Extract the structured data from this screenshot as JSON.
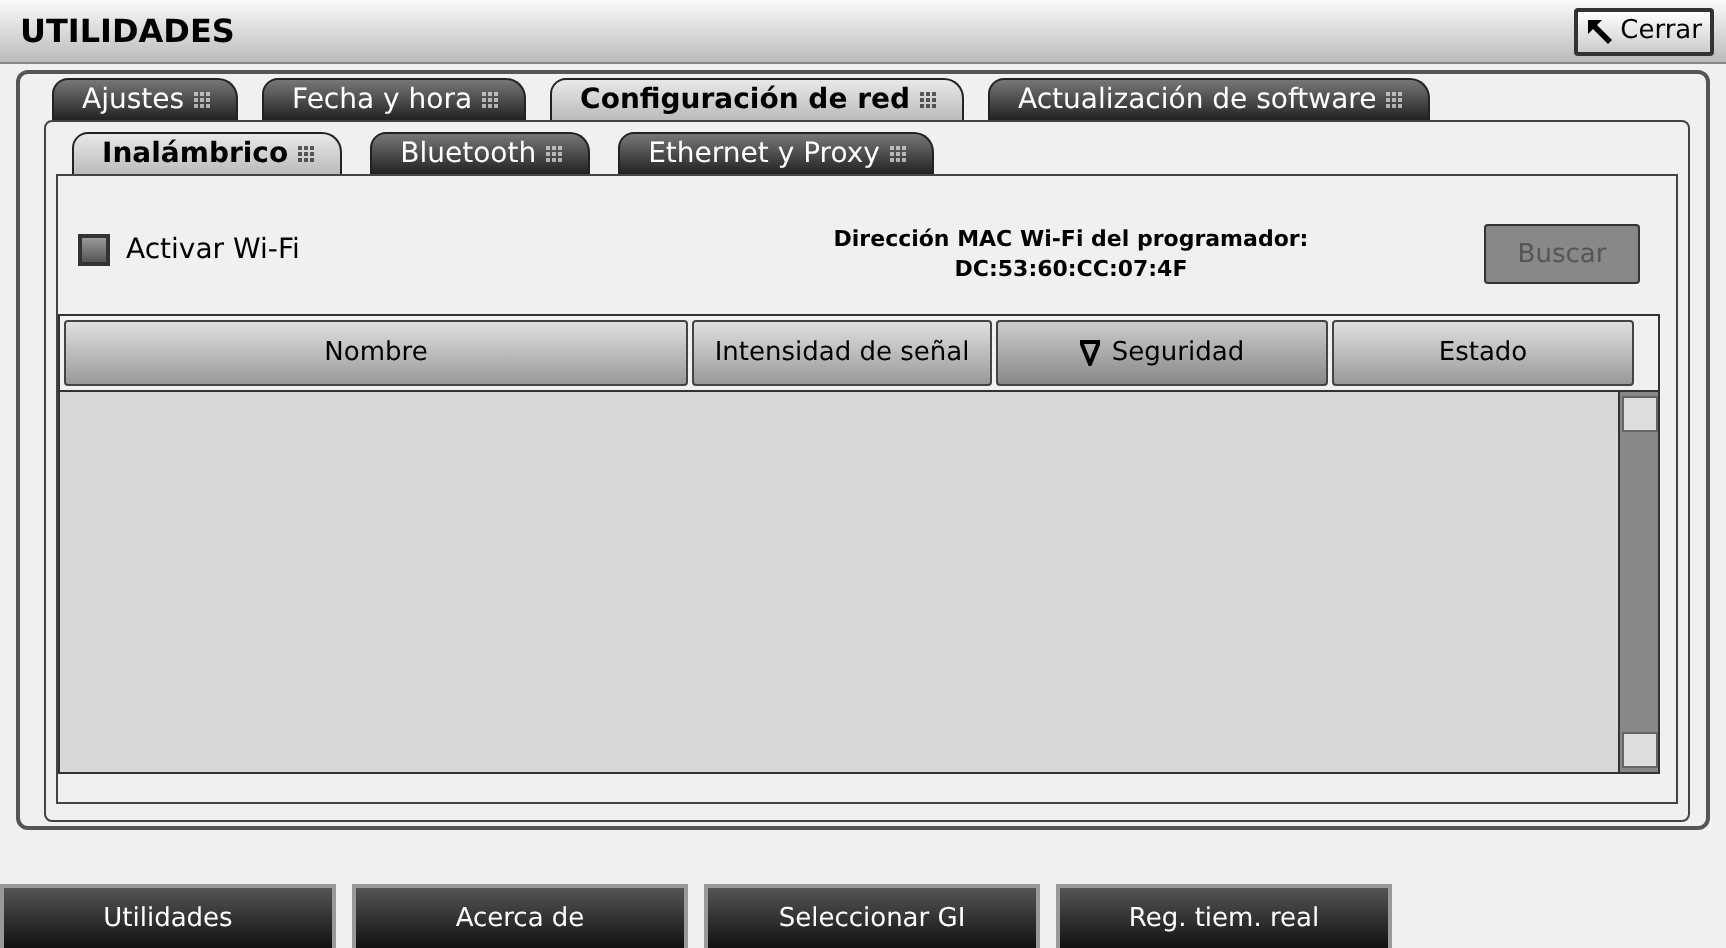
{
  "window": {
    "title": "UTILIDADES",
    "close_button": "Cerrar"
  },
  "tabs": [
    {
      "label": "Ajustes",
      "selected": false
    },
    {
      "label": "Fecha y hora",
      "selected": false
    },
    {
      "label": "Configuración de red",
      "selected": true
    },
    {
      "label": "Actualización de software",
      "selected": false
    }
  ],
  "subtabs": [
    {
      "label": "Inalámbrico",
      "selected": true
    },
    {
      "label": "Bluetooth",
      "selected": false
    },
    {
      "label": "Ethernet y Proxy",
      "selected": false
    }
  ],
  "wifi": {
    "label": "Activar Wi-Fi",
    "checked": false
  },
  "mac": {
    "label": "Dirección MAC Wi-Fi del programador:",
    "value": "DC:53:60:CC:07:4F"
  },
  "search_button": {
    "label": "Buscar",
    "disabled": true
  },
  "table": {
    "columns": [
      {
        "label": "Nombre",
        "sorted": false
      },
      {
        "label": "Intensidad de señal",
        "sorted": false
      },
      {
        "label": "Seguridad",
        "sorted": true
      },
      {
        "label": "Estado",
        "sorted": false
      }
    ]
  },
  "nav": [
    "Utilidades",
    "Acerca de",
    "Seleccionar GI",
    "Reg. tiem. real"
  ]
}
